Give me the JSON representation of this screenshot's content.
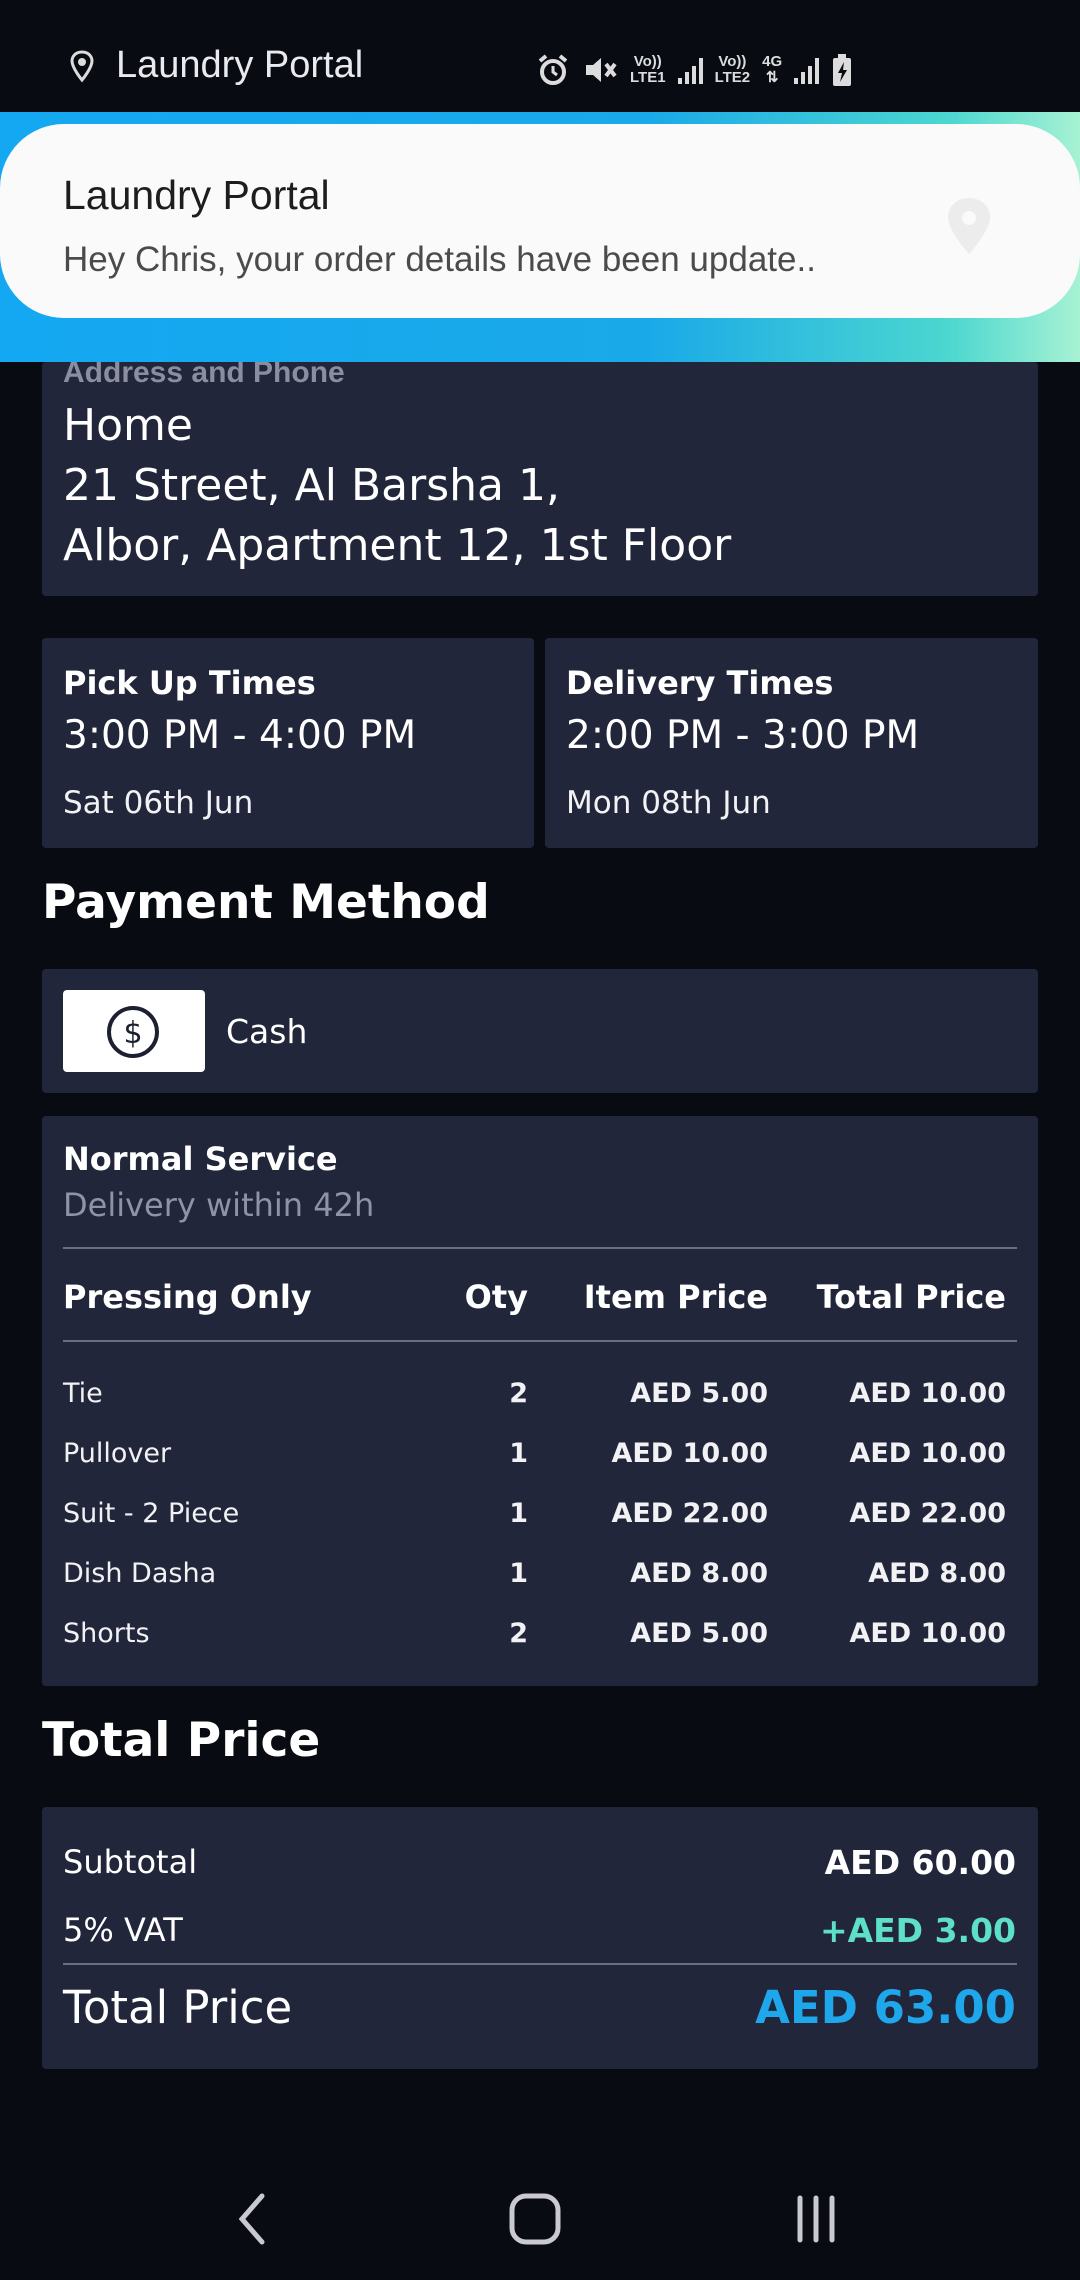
{
  "colors": {
    "background": "#090b12",
    "card": "#22263a",
    "accent_blue": "#1ea7ea",
    "vat_green": "#5ee0c8",
    "notification_gradient": [
      "#14a8f2",
      "#a7f2d3"
    ]
  },
  "status_bar": {
    "app_title": "Laundry Portal",
    "icons": [
      "location-pin-icon",
      "alarm-icon",
      "mute-icon",
      "volte-lte1-icon",
      "signal-icon",
      "volte-lte2-icon",
      "4g-icon",
      "signal-icon",
      "battery-charging-icon"
    ],
    "sim1": {
      "top": "Vo))",
      "bottom": "LTE1"
    },
    "sim2": {
      "top": "Vo))",
      "bottom": "LTE2"
    },
    "network": "4G"
  },
  "notification": {
    "app_name": "Laundry Portal",
    "message": "Hey Chris, your order details have been update.."
  },
  "address": {
    "heading": "Address and Phone",
    "lines": [
      "Home",
      "21 Street, Al Barsha 1,",
      "Albor, Apartment 12, 1st Floor"
    ]
  },
  "pickup": {
    "heading": "Pick Up Times",
    "time_range": "3:00 PM - 4:00 PM",
    "date": "Sat 06th Jun"
  },
  "delivery": {
    "heading": "Delivery Times",
    "time_range": "2:00 PM - 3:00 PM",
    "date": "Mon 08th Jun"
  },
  "payment": {
    "title": "Payment Method",
    "method": "Cash",
    "icon": "dollar-circle-icon"
  },
  "service": {
    "name": "Normal Service",
    "subtitle": "Delivery within 42h",
    "headers": [
      "Pressing Only",
      "Oty",
      "Item Price",
      "Total Price"
    ],
    "items": [
      {
        "name": "Tie",
        "qty": "2",
        "item_price": "AED 5.00",
        "total_price": "AED 10.00"
      },
      {
        "name": "Pullover",
        "qty": "1",
        "item_price": "AED 10.00",
        "total_price": "AED 10.00"
      },
      {
        "name": "Suit - 2 Piece",
        "qty": "1",
        "item_price": "AED 22.00",
        "total_price": "AED 22.00"
      },
      {
        "name": "Dish Dasha",
        "qty": "1",
        "item_price": "AED 8.00",
        "total_price": "AED 8.00"
      },
      {
        "name": "Shorts",
        "qty": "2",
        "item_price": "AED 5.00",
        "total_price": "AED 10.00"
      }
    ]
  },
  "totals": {
    "title": "Total Price",
    "subtotal_label": "Subtotal",
    "subtotal_value": "AED 60.00",
    "vat_label": "5% VAT",
    "vat_value": "+AED 3.00",
    "total_label": "Total Price",
    "total_value": "AED 63.00"
  },
  "nav": {
    "back_icon": "back-chevron-icon",
    "home_icon": "home-rounded-square-icon",
    "recents_icon": "recents-bars-icon"
  }
}
